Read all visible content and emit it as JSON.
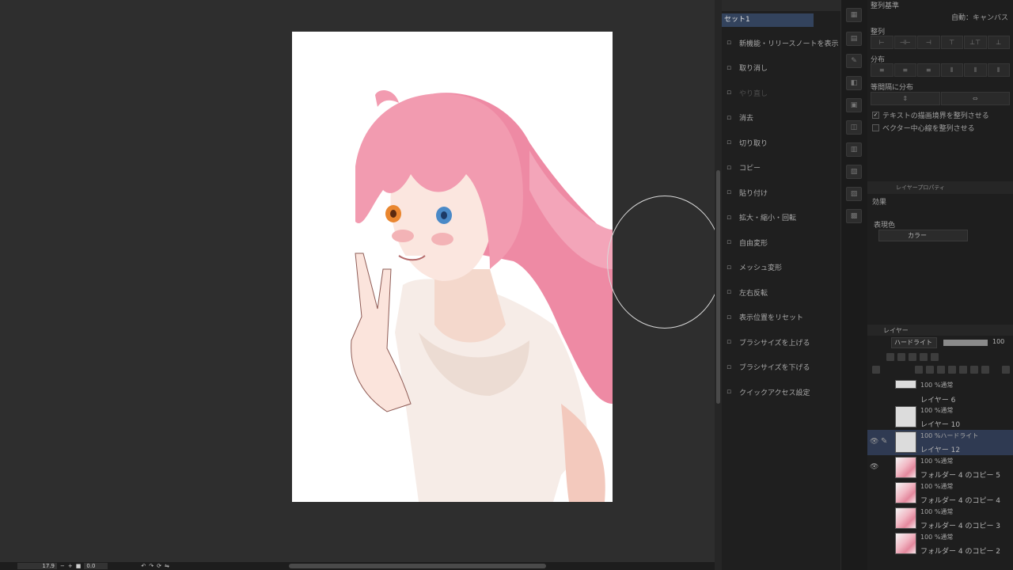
{
  "canvas": {
    "artwork_description": "anime illustration of girl with long pink hair giving peace sign"
  },
  "statusbar": {
    "zoom": "17.9",
    "angle": "0.0",
    "icons": [
      "minus-icon",
      "plus-icon",
      "fit-icon",
      "rotate-left-icon",
      "rotate-right-icon",
      "reset-rotation-icon",
      "flip-icon"
    ]
  },
  "quick_access": {
    "set_name": "セット1",
    "items": [
      {
        "label": "新機能・リリースノートを表示",
        "icon": "news-icon"
      },
      {
        "label": "取り消し",
        "icon": "undo-icon"
      },
      {
        "label": "やり直し",
        "icon": "redo-icon",
        "disabled": true
      },
      {
        "label": "消去",
        "icon": "clear-icon"
      },
      {
        "label": "切り取り",
        "icon": "cut-icon"
      },
      {
        "label": "コピー",
        "icon": "copy-icon"
      },
      {
        "label": "貼り付け",
        "icon": "paste-icon"
      },
      {
        "label": "拡大・縮小・回転",
        "icon": "transform-icon"
      },
      {
        "label": "自由変形",
        "icon": "free-transform-icon"
      },
      {
        "label": "メッシュ変形",
        "icon": "mesh-transform-icon"
      },
      {
        "label": "左右反転",
        "icon": "flip-horizontal-icon"
      },
      {
        "label": "表示位置をリセット",
        "icon": "reset-view-icon"
      },
      {
        "label": "ブラシサイズを上げる",
        "icon": "brush-up-icon"
      },
      {
        "label": "ブラシサイズを下げる",
        "icon": "brush-down-icon"
      },
      {
        "label": "クイックアクセス設定",
        "icon": "quick-settings-icon"
      }
    ]
  },
  "align_panel": {
    "basis_label": "整列基準",
    "basis_value": "自動：キャンバス",
    "align_label": "整列",
    "distribute_label": "分布",
    "equal_spacing_label": "等間隔に分布",
    "check_text_bounds": "テキストの描画境界を整列させる",
    "check_text_bounds_checked": true,
    "check_vector_centerline": "ベクター中心線を整列させる",
    "check_vector_centerline_checked": false
  },
  "layer_property": {
    "header": "レイヤープロパティ",
    "effect_label": "効果",
    "color_mode_label": "表現色",
    "color_mode_value": "カラー"
  },
  "layer_panel": {
    "header": "レイヤー",
    "blend_mode": "ハードライト",
    "opacity": "100",
    "opacity_fraction": 1.0,
    "layers": [
      {
        "mode": "100 %通常",
        "name": "",
        "thumb": "gray",
        "short": true
      },
      {
        "mode": "",
        "name": "レイヤー 6",
        "thumb": "none"
      },
      {
        "mode": "100 %通常",
        "name": "レイヤー 10",
        "thumb": "gray"
      },
      {
        "mode": "100 %ハードライト",
        "name": "レイヤー 12",
        "thumb": "gray",
        "selected": true,
        "visible": true,
        "editing": true
      },
      {
        "mode": "100 %通常",
        "name": "フォルダー 4 のコピー 5",
        "thumb": "pink",
        "visible": true
      },
      {
        "mode": "100 %通常",
        "name": "フォルダー 4 のコピー 4",
        "thumb": "pink"
      },
      {
        "mode": "100 %通常",
        "name": "フォルダー 4 のコピー 3",
        "thumb": "pink"
      },
      {
        "mode": "100 %通常",
        "name": "フォルダー 4 のコピー 2",
        "thumb": "pink"
      }
    ]
  }
}
